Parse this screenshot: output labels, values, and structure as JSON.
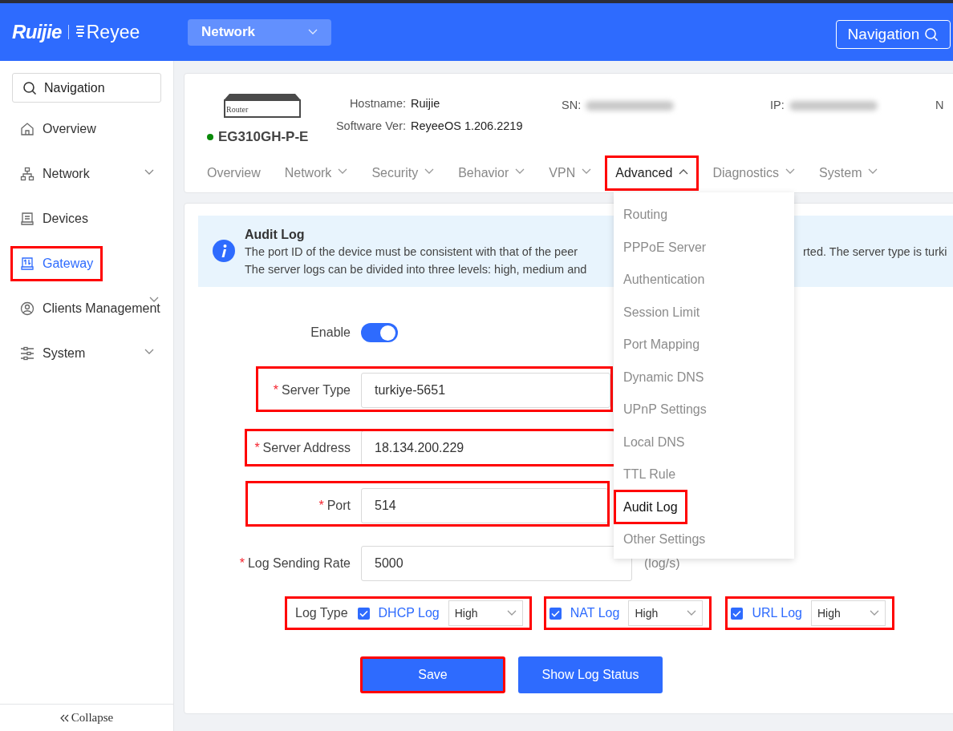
{
  "header": {
    "logo": "Ruijie",
    "logo_sub": "Reyee",
    "network_select": "Network",
    "navigation_button": "Navigation"
  },
  "sidebar": {
    "search_placeholder": "Navigation",
    "items": [
      {
        "label": "Overview",
        "expandable": false,
        "selected": false,
        "highlighted": false
      },
      {
        "label": "Network",
        "expandable": true,
        "selected": false,
        "highlighted": false
      },
      {
        "label": "Devices",
        "expandable": false,
        "selected": false,
        "highlighted": false
      },
      {
        "label": "Gateway",
        "expandable": false,
        "selected": true,
        "highlighted": true
      },
      {
        "label": "Clients Management",
        "expandable": true,
        "selected": false,
        "highlighted": false
      },
      {
        "label": "System",
        "expandable": true,
        "selected": false,
        "highlighted": false
      }
    ],
    "collapse": "Collapse"
  },
  "device": {
    "image_label": "Router",
    "online": true,
    "model": "EG310GH-P-E",
    "fields": [
      {
        "label": "Hostname:",
        "value": "Ruijie"
      },
      {
        "label": "Software Ver:",
        "value": "ReyeeOS 1.206.2219"
      },
      {
        "label": "SN:",
        "blurred": true
      },
      {
        "label": "IP:",
        "blurred": true
      },
      {
        "label": "N"
      }
    ]
  },
  "tabs": [
    {
      "label": "Overview",
      "has_menu": false,
      "selected": false,
      "expanded": false,
      "highlighted": false
    },
    {
      "label": "Network",
      "has_menu": true,
      "selected": false,
      "expanded": false,
      "highlighted": false
    },
    {
      "label": "Security",
      "has_menu": true,
      "selected": false,
      "expanded": false,
      "highlighted": false
    },
    {
      "label": "Behavior",
      "has_menu": true,
      "selected": false,
      "expanded": false,
      "highlighted": false
    },
    {
      "label": "VPN",
      "has_menu": true,
      "selected": false,
      "expanded": false,
      "highlighted": false
    },
    {
      "label": "Advanced",
      "has_menu": true,
      "selected": true,
      "expanded": true,
      "highlighted": true
    },
    {
      "label": "Diagnostics",
      "has_menu": true,
      "selected": false,
      "expanded": false,
      "highlighted": false
    },
    {
      "label": "System",
      "has_menu": true,
      "selected": false,
      "expanded": false,
      "highlighted": false
    }
  ],
  "dropdown": {
    "items": [
      {
        "label": "Routing",
        "selected": false,
        "highlighted": false
      },
      {
        "label": "PPPoE Server",
        "selected": false,
        "highlighted": false
      },
      {
        "label": "Authentication",
        "selected": false,
        "highlighted": false
      },
      {
        "label": "Session Limit",
        "selected": false,
        "highlighted": false
      },
      {
        "label": "Port Mapping",
        "selected": false,
        "highlighted": false
      },
      {
        "label": "Dynamic DNS",
        "selected": false,
        "highlighted": false
      },
      {
        "label": "UPnP Settings",
        "selected": false,
        "highlighted": false
      },
      {
        "label": "Local DNS",
        "selected": false,
        "highlighted": false
      },
      {
        "label": "TTL Rule",
        "selected": false,
        "highlighted": false
      },
      {
        "label": "Audit Log",
        "selected": true,
        "highlighted": true
      },
      {
        "label": "Other Settings",
        "selected": false,
        "highlighted": false
      }
    ]
  },
  "info": {
    "title": "Audit Log",
    "lines": [
      {
        "left": "The port ID of the device must be consistent with that of the peer",
        "right": "rted. The server type is turki"
      },
      {
        "left": "The server logs can be divided into three levels: high, medium and"
      }
    ]
  },
  "form": {
    "enable": {
      "label": "Enable",
      "on": true
    },
    "fields": [
      {
        "label": "Server Type",
        "required_mark": "*",
        "value": "turkiye-5651",
        "highlighted": true
      },
      {
        "label": "Server Address",
        "required_mark": "*",
        "value": "18.134.200.229",
        "highlighted": true
      },
      {
        "label": "Port",
        "required_mark": "*",
        "value": "514",
        "highlighted": true
      },
      {
        "label": "Log Sending Rate",
        "required_mark": "*",
        "value": "5000",
        "unit": "(log/s)",
        "highlighted": false
      }
    ],
    "log_type": {
      "label": "Log Type",
      "options": [
        {
          "label": "DHCP Log",
          "checked": true,
          "severity": "High",
          "highlighted": true
        },
        {
          "label": "NAT Log",
          "checked": true,
          "severity": "High",
          "highlighted": true
        },
        {
          "label": "URL Log",
          "checked": true,
          "severity": "High",
          "highlighted": true
        }
      ]
    }
  },
  "buttons": [
    {
      "label": "Save",
      "highlighted": true
    },
    {
      "label": "Show Log Status",
      "highlighted": false
    }
  ]
}
